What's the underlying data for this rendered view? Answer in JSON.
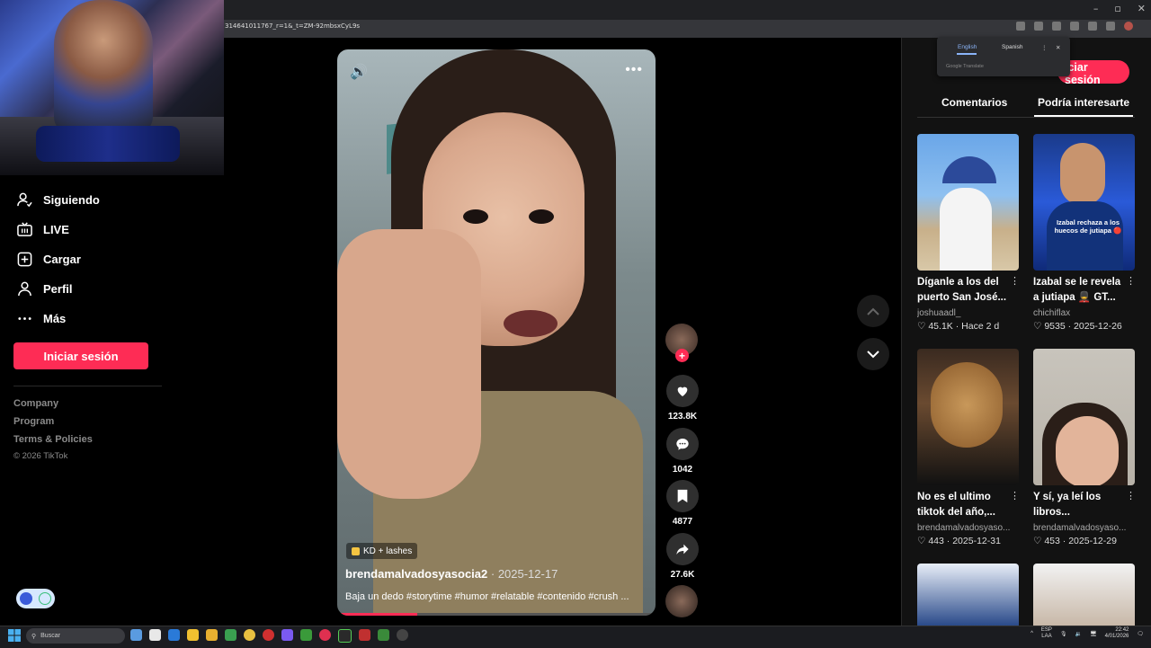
{
  "browser": {
    "url": "314641011767_r=1&_t=ZM-92mbsxCyL9s",
    "window_controls": [
      "–",
      "▫",
      "✕"
    ]
  },
  "translate_popup": {
    "tab_english": "English",
    "tab_spanish": "Spanish",
    "footer": "Google Translate",
    "more": "⋮",
    "close": "✕"
  },
  "sidebar": {
    "items": [
      {
        "label": "Siguiendo",
        "icon": "following-icon"
      },
      {
        "label": "LIVE",
        "icon": "live-icon"
      },
      {
        "label": "Cargar",
        "icon": "upload-icon"
      },
      {
        "label": "Perfil",
        "icon": "profile-icon"
      },
      {
        "label": "Más",
        "icon": "more-icon"
      }
    ],
    "login_button": "Iniciar sesión",
    "footer_links": [
      "Company",
      "Program",
      "Terms & Policies"
    ],
    "copyright": "© 2026 TikTok"
  },
  "video": {
    "badge": "KD + lashes",
    "username": "brendamalvadosyasocia2",
    "separator": " · ",
    "date": "2025-12-17",
    "caption": "Baja un dedo #storytime #humor #relatable #contenido #crush ...",
    "progress": 0.25
  },
  "actions": {
    "likes": "123.8K",
    "comments": "1042",
    "saves": "4877",
    "shares": "27.6K"
  },
  "right_panel": {
    "login_button": "iciar sesión",
    "tabs": [
      "Comentarios",
      "Podría interesarte"
    ],
    "active_tab": 1,
    "cards": [
      {
        "title": "Díganle a los del puerto San José...",
        "author": "joshuaadl_",
        "likes": "45.1K",
        "date": "Hace 2 d"
      },
      {
        "title": "Izabal se le revela a jutiapa 💂 GT...",
        "author": "chichiflax",
        "likes": "9535",
        "date": "2025-12-26",
        "thumb_text": "Izabal rechaza a los huecos de jutiapa 🔴"
      },
      {
        "title": "No es el ultimo tiktok del año,...",
        "author": "brendamalvadosyaso...",
        "likes": "443",
        "date": "2025-12-31"
      },
      {
        "title": "Y sí, ya leí los libros...",
        "author": "brendamalvadosyaso...",
        "likes": "453",
        "date": "2025-12-29"
      }
    ]
  },
  "taskbar": {
    "search": "Buscar",
    "lang_top": "ESP",
    "lang_bottom": "LAA",
    "time": "22:42",
    "date": "4/01/2026"
  }
}
